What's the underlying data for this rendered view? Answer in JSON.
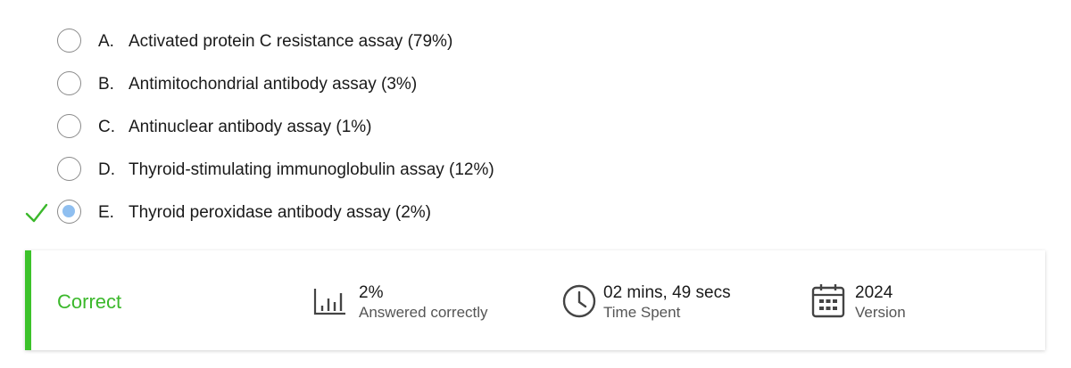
{
  "options": [
    {
      "letter": "A.",
      "text": "Activated protein C resistance assay (79%)"
    },
    {
      "letter": "B.",
      "text": "Antimitochondrial antibody assay (3%)"
    },
    {
      "letter": "C.",
      "text": "Antinuclear antibody assay (1%)"
    },
    {
      "letter": "D.",
      "text": "Thyroid-stimulating immunoglobulin assay (12%)"
    },
    {
      "letter": "E.",
      "text": "Thyroid peroxidase antibody assay (2%)"
    }
  ],
  "selected_option": "E.",
  "result": {
    "status": "Correct",
    "status_color": "#3bb82b",
    "stats": {
      "percent_value": "2%",
      "percent_label": "Answered correctly",
      "time_value": "02 mins, 49 secs",
      "time_label": "Time Spent",
      "version_value": "2024",
      "version_label": "Version"
    }
  },
  "icons": [
    "check-icon",
    "bar-chart-icon",
    "clock-icon",
    "calendar-icon"
  ]
}
